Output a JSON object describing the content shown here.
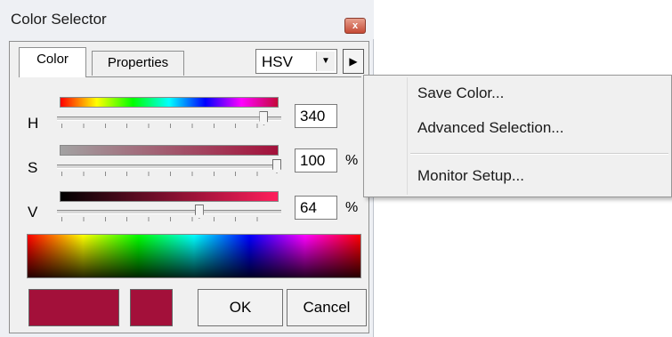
{
  "window": {
    "title": "Color Selector",
    "close_glyph": "x"
  },
  "tabs": [
    {
      "label": "Color",
      "active": true
    },
    {
      "label": "Properties",
      "active": false
    }
  ],
  "mode_select": {
    "value": "HSV"
  },
  "sliders": [
    {
      "label": "H",
      "value": "340",
      "unit": "",
      "fraction": 0.94
    },
    {
      "label": "S",
      "value": "100",
      "unit": "%",
      "fraction": 1.0
    },
    {
      "label": "V",
      "value": "64",
      "unit": "%",
      "fraction": 0.64
    }
  ],
  "colors": {
    "current": "#a3103a",
    "previous": "#a3103a",
    "title_close": "#c54a36"
  },
  "buttons": {
    "ok": "OK",
    "cancel": "Cancel"
  },
  "context_menu": {
    "items": [
      "Save Color...",
      "Advanced Selection...",
      "Monitor Setup..."
    ]
  }
}
